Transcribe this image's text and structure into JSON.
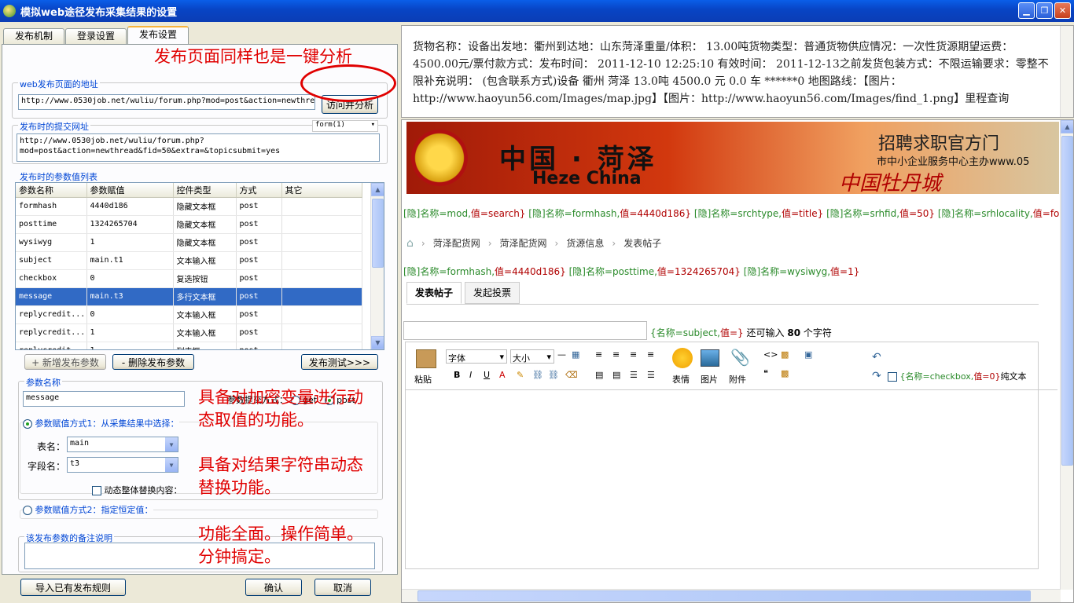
{
  "window": {
    "title": "模拟web途径发布采集结果的设置"
  },
  "tabs": [
    "发布机制",
    "登录设置",
    "发布设置"
  ],
  "publish_url": {
    "group_label": "web发布页面的地址",
    "value": "http://www.0530job.net/wuliu/forum.php?mod=post&action=newthre",
    "visit_btn": "访问并分析"
  },
  "submit_url": {
    "group_label": "发布时的提交网址",
    "form_select": "form(1)",
    "value_line1": "http://www.0530job.net/wuliu/forum.php?",
    "value_line2": "mod=post&action=newthread&fid=50&extra=&topicsubmit=yes"
  },
  "params": {
    "group_label": "发布时的参数值列表",
    "headers": [
      "参数名称",
      "参数赋值",
      "控件类型",
      "方式",
      "其它"
    ],
    "rows": [
      [
        "formhash",
        "4440d186",
        "隐藏文本框",
        "post",
        ""
      ],
      [
        "posttime",
        "1324265704",
        "隐藏文本框",
        "post",
        ""
      ],
      [
        "wysiwyg",
        "1",
        "隐藏文本框",
        "post",
        ""
      ],
      [
        "subject",
        "main.t1",
        "文本输入框",
        "post",
        ""
      ],
      [
        "checkbox",
        "0",
        "复选按钮",
        "post",
        ""
      ],
      [
        "message",
        "main.t3",
        "多行文本框",
        "post",
        ""
      ],
      [
        "replycredit...",
        "0",
        "文本输入框",
        "post",
        ""
      ],
      [
        "replycredit...",
        "1",
        "文本输入框",
        "post",
        ""
      ],
      [
        "replycredit...",
        "1",
        "列表框",
        "post",
        ""
      ]
    ]
  },
  "buttons": {
    "add": "+ 新增发布参数",
    "del": "- 删除发布参数",
    "test": "发布测试>>>",
    "import": "导入已有发布规则",
    "ok": "确认",
    "cancel": "取消"
  },
  "param_detail": {
    "group_label": "参数名称",
    "name": "message",
    "submit_label": "参数提交方式：",
    "get": "get",
    "post": "post",
    "mode1": "参数赋值方式1：从采集结果中选择：",
    "table_label": "表名：",
    "table_value": "main",
    "field_label": "字段名：",
    "field_value": "t3",
    "replace_label": "动态整体替换内容：",
    "mode2": "参数赋值方式2：指定恒定值："
  },
  "remark": {
    "group_label": "该发布参数的备注说明"
  },
  "annotations": {
    "a1": "发布页面同样也是一键分析",
    "a2_1": "具备对加密变量进行动",
    "a2_2": "态取值的功能。",
    "a3_1": "具备对结果字符串动态",
    "a3_2": "替换功能。",
    "a4_1": "功能全面。操作简单。",
    "a4_2": "分钟搞定。"
  },
  "info": {
    "text": "货物名称：设备出发地：衢州到达地：山东菏泽重量/体积： 13.00吨货物类型：普通货物供应情况：一次性货源期望运费： 4500.00元/票付款方式：发布时间： 2011-12-10 12:25:10 有效时间： 2011-12-13之前发货包装方式：不限运输要求：零整不限补充说明： (包含联系方式)设备 衢州 菏泽 13.0吨 4500.0 元 0.0 车 ******0 地图路线：【图片：http://www.haoyun56.com/Images/map.jpg】【图片：http://www.haoyun56.com/Images/find_1.png】里程查询"
  },
  "banner": {
    "cn": "中国 · 菏泽",
    "en": "Heze China",
    "recruit": "招聘求职官方门",
    "sub": "市中小企业服务中心主办www.05",
    "calli": "中国牡丹城"
  },
  "hidden1": [
    [
      "[隐]名称=mod,",
      "值=search}"
    ],
    [
      "[隐]名称=formhash,",
      "值=4440d186}"
    ],
    [
      "[隐]名称=srchtype,",
      "值=title}"
    ],
    [
      "[隐]名称=srhfid,",
      "值=50}"
    ],
    [
      "[隐]名称=srhlocality,",
      "值=forum:"
    ]
  ],
  "breadcrumb": [
    "菏泽配货网",
    "菏泽配货网",
    "货源信息",
    "发表帖子"
  ],
  "hidden2": [
    [
      "[隐]名称=formhash,",
      "值=4440d186}"
    ],
    [
      "[隐]名称=posttime,",
      "值=1324265704}"
    ],
    [
      "[隐]名称=wysiwyg,",
      "值=1}"
    ]
  ],
  "post_tabs": [
    "发表帖子",
    "发起投票"
  ],
  "subject_hint": {
    "k": "{名称=subject,",
    "v": "值=}",
    "rest1": "还可输入",
    "num": "80",
    "rest2": "个字符"
  },
  "editor": {
    "paste": "粘贴",
    "font": "字体",
    "size": "大小",
    "emoji": "表情",
    "image": "图片",
    "attach": "附件",
    "check_k": "{名称=checkbox,",
    "check_v": "值=0}",
    "check_rest": "纯文本"
  }
}
